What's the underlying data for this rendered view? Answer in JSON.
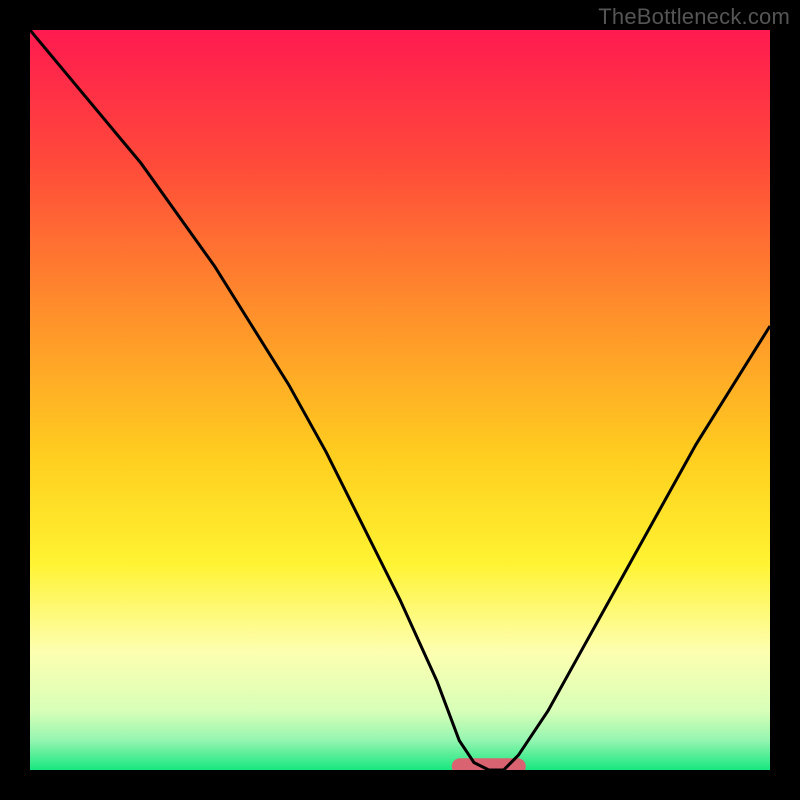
{
  "watermark": "TheBottleneck.com",
  "chart_data": {
    "type": "line",
    "title": "",
    "xlabel": "",
    "ylabel": "",
    "legend": false,
    "grid": false,
    "xlim": [
      0,
      100
    ],
    "ylim": [
      0,
      100
    ],
    "background_gradient_stops": [
      {
        "offset": 0.0,
        "color": "#ff1a50"
      },
      {
        "offset": 0.18,
        "color": "#ff4a3a"
      },
      {
        "offset": 0.38,
        "color": "#ff8f2b"
      },
      {
        "offset": 0.58,
        "color": "#ffcf1f"
      },
      {
        "offset": 0.72,
        "color": "#fff332"
      },
      {
        "offset": 0.84,
        "color": "#fdffb0"
      },
      {
        "offset": 0.92,
        "color": "#d8ffb8"
      },
      {
        "offset": 0.96,
        "color": "#94f5b0"
      },
      {
        "offset": 1.0,
        "color": "#17e77f"
      }
    ],
    "series": [
      {
        "name": "bottleneck-curve",
        "color": "#000000",
        "x": [
          0,
          5,
          10,
          15,
          20,
          25,
          30,
          35,
          40,
          45,
          50,
          55,
          58,
          60,
          62,
          64,
          66,
          70,
          75,
          80,
          85,
          90,
          95,
          100
        ],
        "y": [
          100,
          94,
          88,
          82,
          75,
          68,
          60,
          52,
          43,
          33,
          23,
          12,
          4,
          1,
          0,
          0,
          2,
          8,
          17,
          26,
          35,
          44,
          52,
          60
        ]
      }
    ],
    "marker": {
      "name": "optimal-zone",
      "color": "#d96370",
      "x_center": 62,
      "half_width": 5,
      "y": 0.5,
      "height": 2.2
    }
  }
}
